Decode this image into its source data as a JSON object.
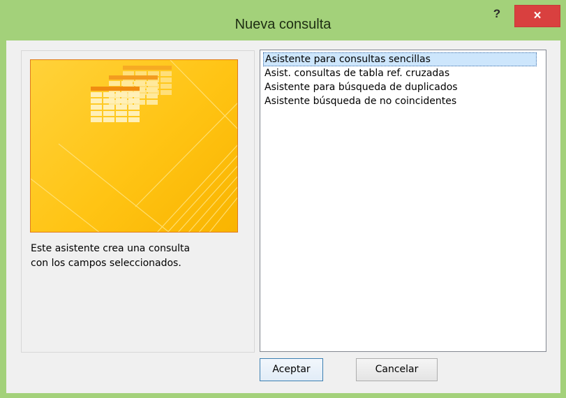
{
  "window": {
    "title": "Nueva consulta",
    "help_label": "?",
    "close_label": "×"
  },
  "preview": {
    "description_lines": [
      "Este asistente crea una consulta",
      "con los campos seleccionados."
    ],
    "icon": "table-grid-icon",
    "colors": {
      "background": "#ffc414",
      "border": "#e07a1a"
    }
  },
  "wizard_list": {
    "selected_index": 0,
    "items": [
      {
        "label": "Asistente para consultas sencillas"
      },
      {
        "label": "Asist. consultas de tabla ref. cruzadas"
      },
      {
        "label": "Asistente para búsqueda de duplicados"
      },
      {
        "label": "Asistente búsqueda de no coincidentes"
      }
    ]
  },
  "buttons": {
    "ok_label": "Aceptar",
    "cancel_label": "Cancelar"
  },
  "colors": {
    "frame": "#a3d17a",
    "close": "#d9403f",
    "selection": "#cde6fc"
  }
}
